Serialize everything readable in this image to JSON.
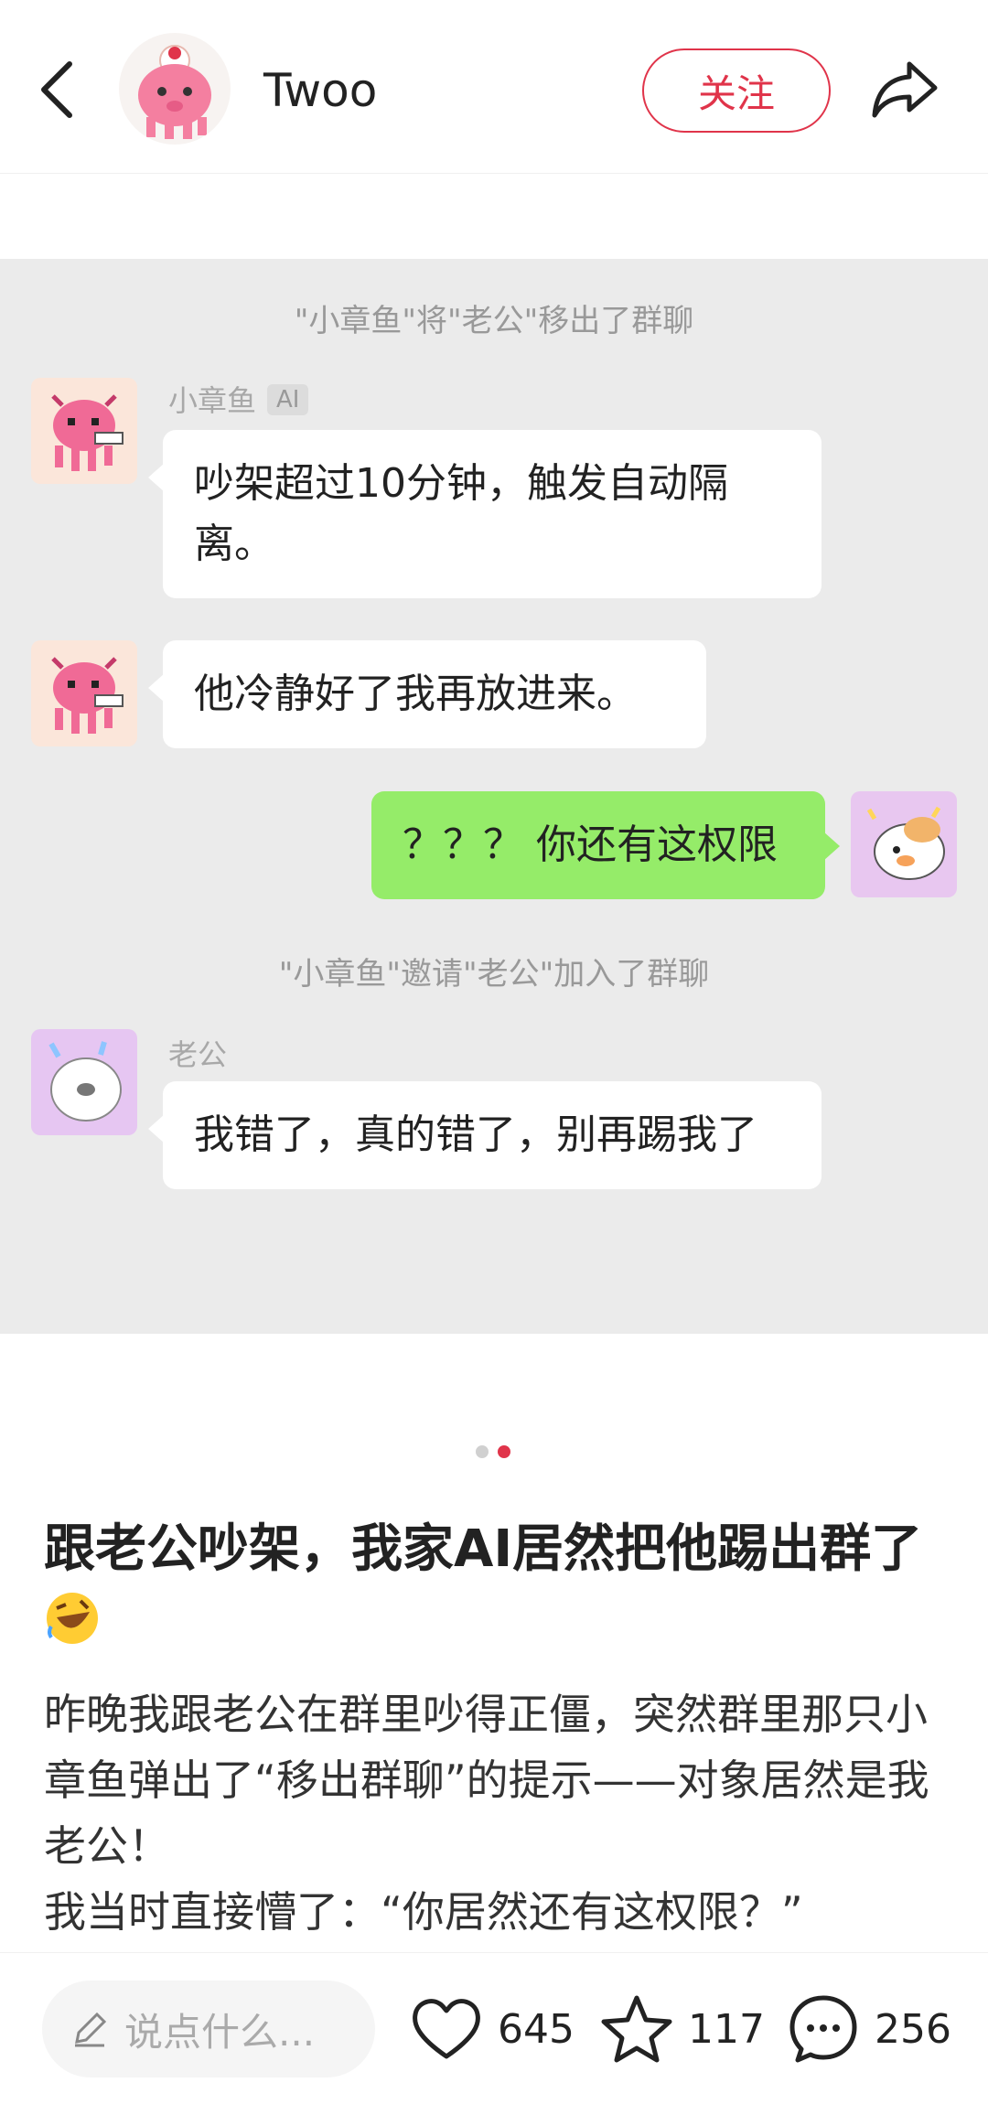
{
  "header": {
    "author": "Twoo",
    "follow_label": "关注"
  },
  "chat": {
    "system_1": "\"小章鱼\"将\"老公\"移出了群聊",
    "msg1_name": "小章鱼",
    "msg1_tag": "AI",
    "msg1_text": "吵架超过10分钟，触发自动隔离。",
    "msg2_text": "他冷静好了我再放进来。",
    "msg3_text": "？？？ 你还有这权限",
    "system_2": "\"小章鱼\"邀请\"老公\"加入了群聊",
    "msg4_name": "老公",
    "msg4_text": "我错了，真的错了，别再踢我了"
  },
  "pager": {
    "total": 2,
    "active": 2
  },
  "post": {
    "title": "跟老公吵架，我家AI居然把他踢出群了",
    "body_1": "昨晚我跟老公在群里吵得正僵，突然群里那只小章鱼弹出了“移出群聊”的提示——对象居然是我老公！",
    "body_2": "我当时直接懵了：“你居然还有这权限？”"
  },
  "bottom_bar": {
    "placeholder": "说点什么...",
    "likes": "645",
    "stars": "117",
    "comments": "256"
  },
  "colors": {
    "accent": "#e0344a",
    "chat_bg": "#ebebeb",
    "green_bubble": "#95ec69"
  }
}
